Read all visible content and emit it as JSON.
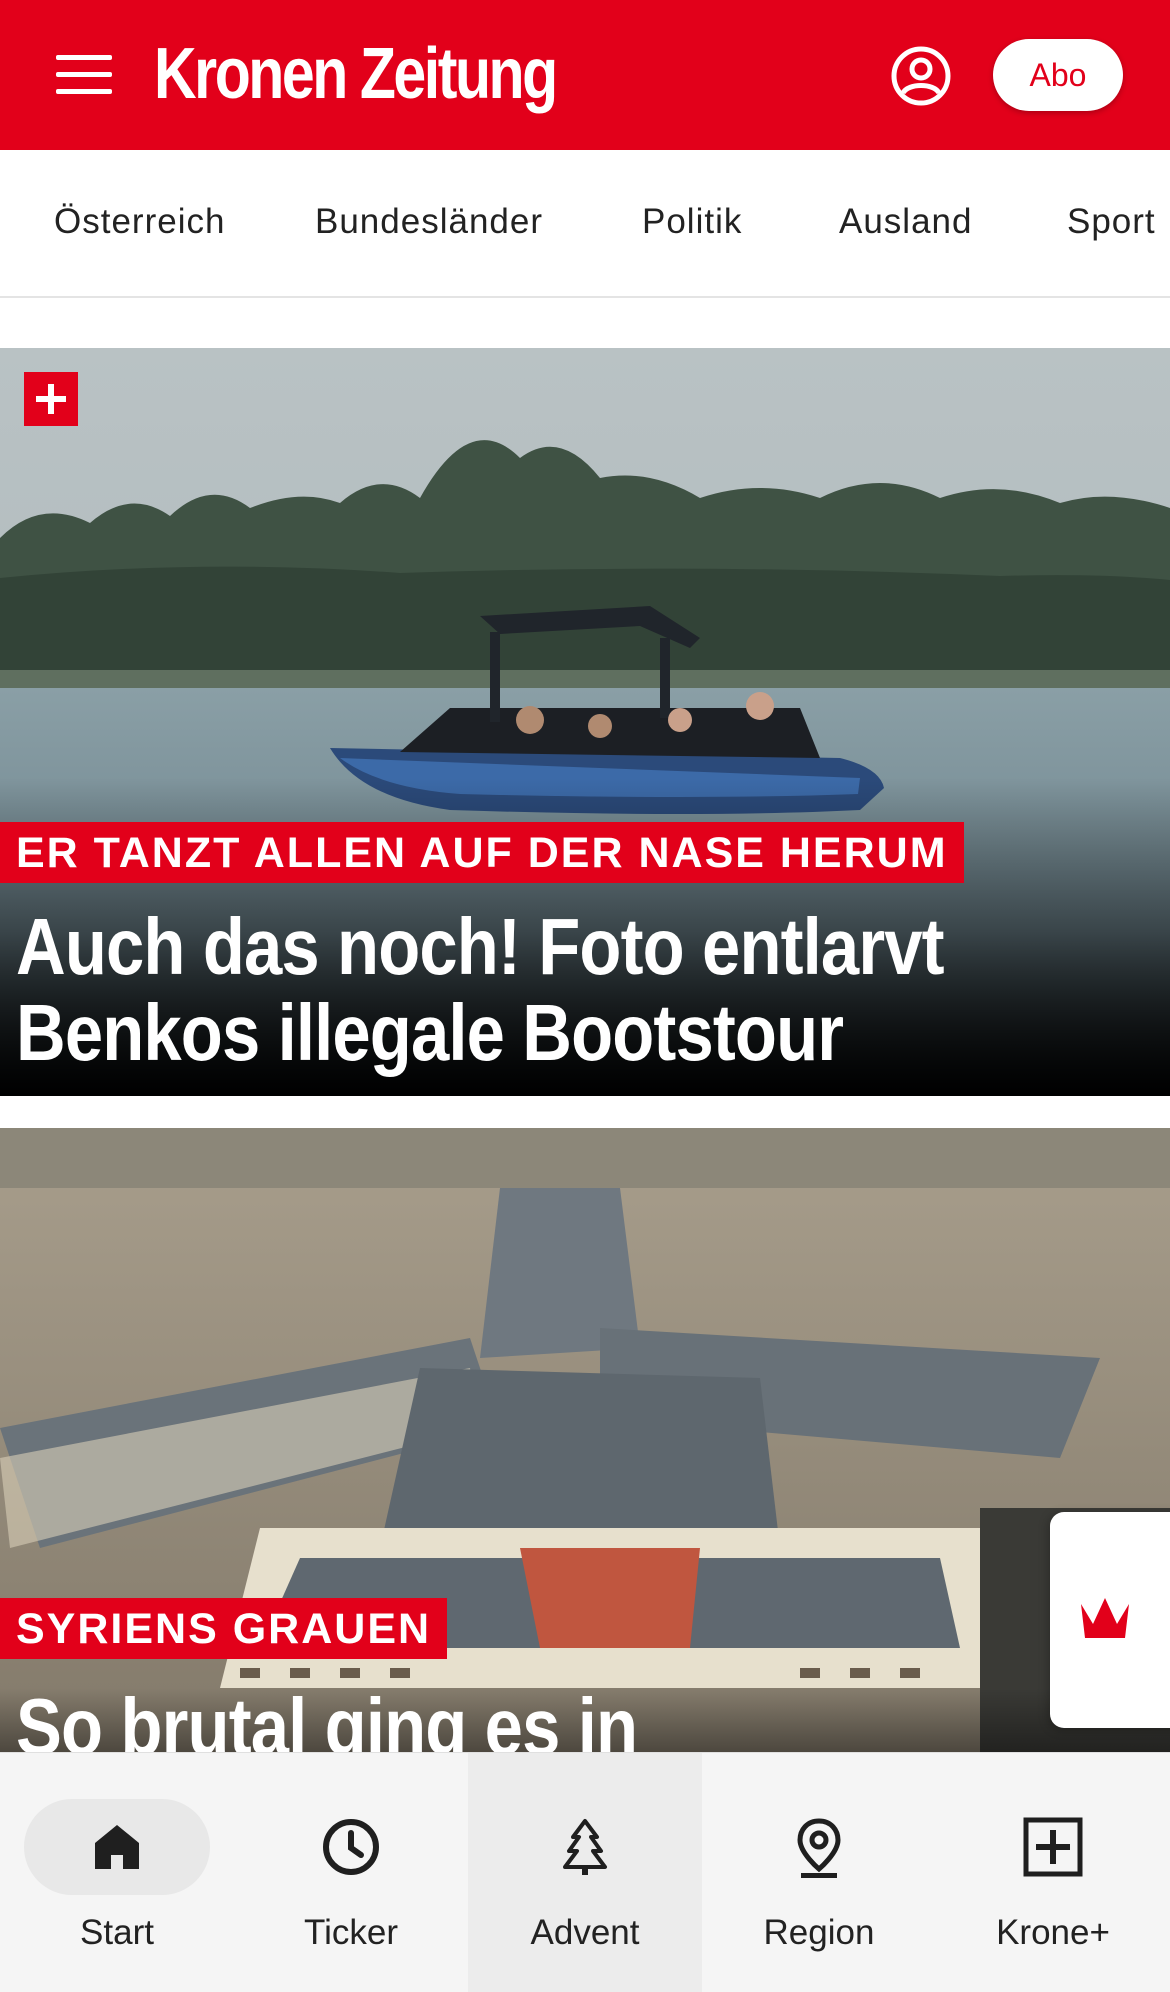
{
  "header": {
    "logo_text": "Kronen Zeitung",
    "abo_label": "Abo",
    "brand_color": "#e2001a"
  },
  "categories": [
    "Österreich",
    "Bundesländer",
    "Politik",
    "Ausland",
    "Sport"
  ],
  "articles": [
    {
      "plus": true,
      "kicker": "ER TANZT ALLEN AUF DER NASE HERUM",
      "headline_line1": "Auch das noch! Foto entlarvt",
      "headline_line2": "Benkos illegale Bootstour"
    },
    {
      "plus": false,
      "kicker": "SYRIENS GRAUEN",
      "headline_line1": "So brutal ging es in"
    }
  ],
  "bottom_nav": {
    "tabs": [
      {
        "label": "Start",
        "icon": "home-icon",
        "selected": true
      },
      {
        "label": "Ticker",
        "icon": "clock-icon",
        "selected": false
      },
      {
        "label": "Advent",
        "icon": "tree-icon",
        "selected": false
      },
      {
        "label": "Region",
        "icon": "location-pin-icon",
        "selected": false
      },
      {
        "label": "Krone+",
        "icon": "plus-square-icon",
        "selected": false
      }
    ]
  }
}
